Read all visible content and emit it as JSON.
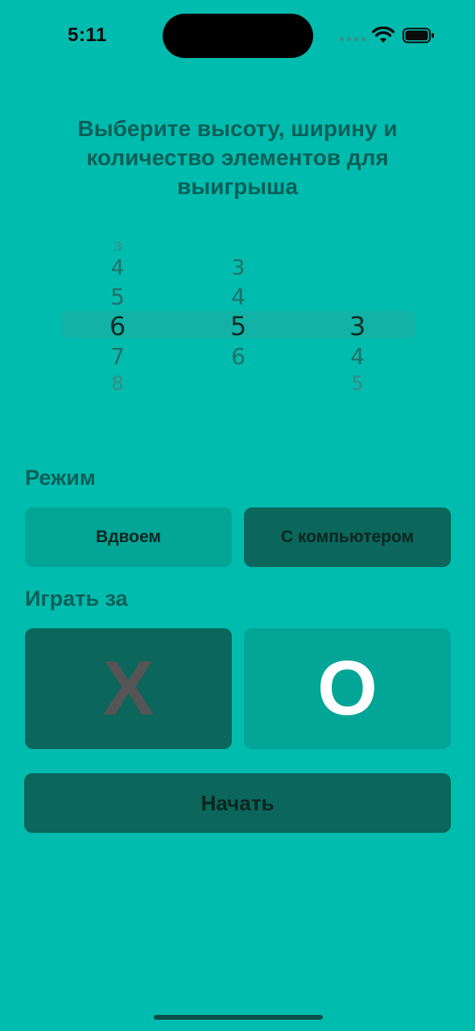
{
  "status_bar": {
    "time": "5:11"
  },
  "title": "Выберите высоту, ширину и количество элементов для выигрыша",
  "picker": {
    "columns": [
      {
        "name": "height",
        "values": [
          "3",
          "4",
          "5",
          "6",
          "7",
          "8"
        ],
        "selected": "6"
      },
      {
        "name": "width",
        "values": [
          "",
          "3",
          "4",
          "5",
          "6",
          ""
        ],
        "selected": "5"
      },
      {
        "name": "win-count",
        "values": [
          "",
          "",
          "",
          "3",
          "4",
          "5"
        ],
        "selected": "3"
      }
    ]
  },
  "mode": {
    "label": "Режим",
    "options": [
      "Вдвоем",
      "С компьютером"
    ],
    "selected": "С компьютером"
  },
  "play_as": {
    "label": "Играть за",
    "options": [
      "X",
      "O"
    ],
    "selected": "X"
  },
  "start_button": "Начать",
  "colors": {
    "background": "#00bcaf",
    "button_light": "#02a596",
    "button_dark": "#0b665b",
    "title_text": "#0b5f57",
    "x_symbol": "#555555",
    "o_symbol": "#ffffff"
  }
}
